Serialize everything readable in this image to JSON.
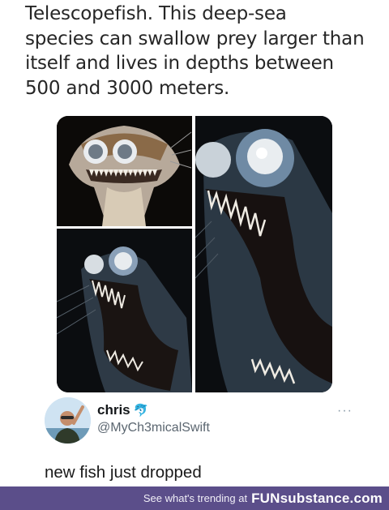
{
  "caption": {
    "lines": [
      "Telescopefish. This deep-sea",
      "species can swallow prey larger than",
      "itself and lives in depths between",
      "500 and 3000 meters."
    ]
  },
  "tweet": {
    "display_name": "chris",
    "badge_icon": "dolphin-icon",
    "handle": "@MyCh3micalSwift",
    "more_label": "···",
    "text": "new fish just dropped"
  },
  "footer": {
    "text": "See what's trending at",
    "brand": "FUNsubstance.com",
    "background": "#5b4e8a"
  }
}
